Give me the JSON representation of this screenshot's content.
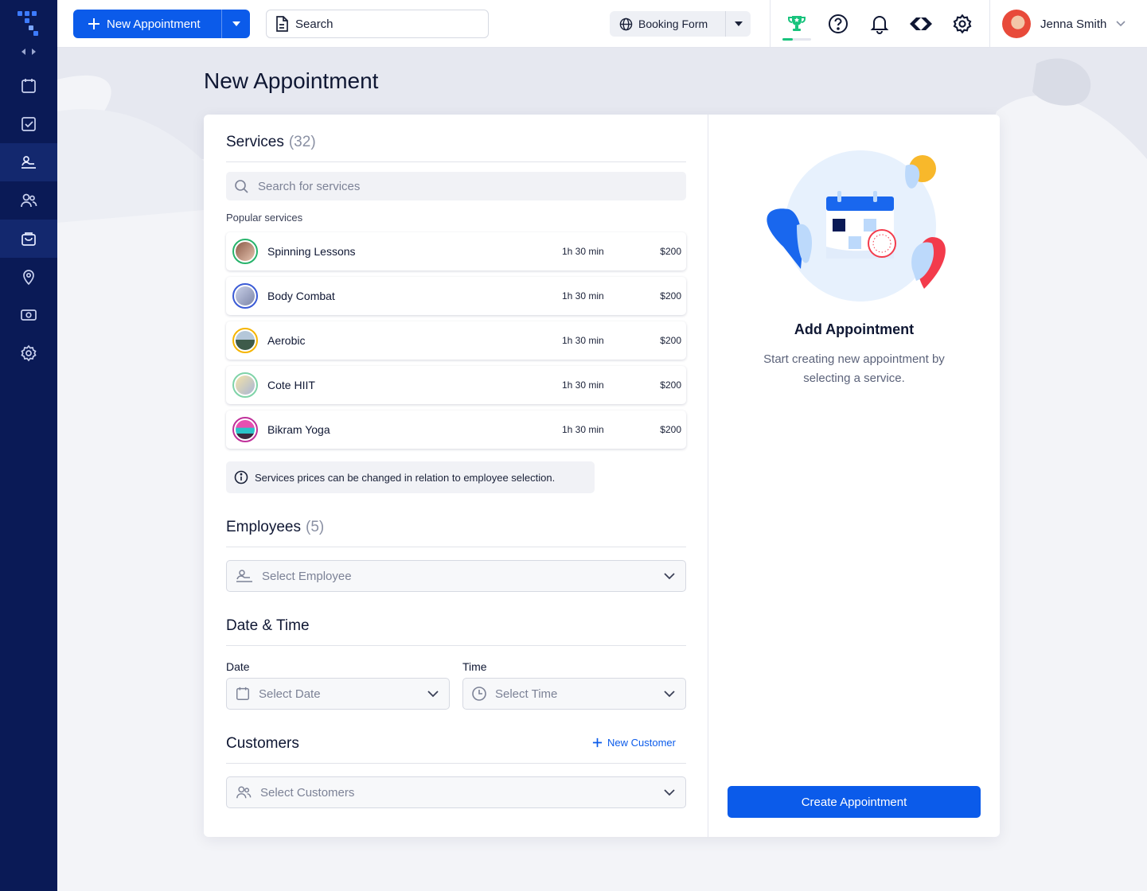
{
  "header": {
    "new_appointment_label": "New Appointment",
    "search_label": "Search",
    "booking_form_label": "Booking Form",
    "user_name": "Jenna Smith"
  },
  "page": {
    "title": "New Appointment"
  },
  "services": {
    "title": "Services",
    "count": "(32)",
    "search_placeholder": "Search for services",
    "popular_label": "Popular services",
    "items": [
      {
        "name": "Spinning Lessons",
        "duration": "1h 30 min",
        "price": "$200",
        "ring": "#27b36b"
      },
      {
        "name": "Body Combat",
        "duration": "1h 30 min",
        "price": "$200",
        "ring": "#3b5bd6"
      },
      {
        "name": "Aerobic",
        "duration": "1h 30 min",
        "price": "$200",
        "ring": "#f5b400"
      },
      {
        "name": "Cote HIIT",
        "duration": "1h 30 min",
        "price": "$200",
        "ring": "#7fd3a8"
      },
      {
        "name": "Bikram Yoga",
        "duration": "1h 30 min",
        "price": "$200",
        "ring": "#c0309a"
      }
    ],
    "note": "Services prices can be changed in relation to employee selection."
  },
  "employees": {
    "title": "Employees",
    "count": "(5)",
    "placeholder": "Select Employee"
  },
  "datetime": {
    "title": "Date & Time",
    "date_label": "Date",
    "date_placeholder": "Select Date",
    "time_label": "Time",
    "time_placeholder": "Select Time"
  },
  "customers": {
    "title": "Customers",
    "new_label": "New Customer",
    "placeholder": "Select Customers"
  },
  "right": {
    "title": "Add Appointment",
    "description": "Start creating new appointment by selecting a service.",
    "create_label": "Create Appointment"
  },
  "colors": {
    "primary": "#0b5bea",
    "sidebar": "#0a1a56",
    "success": "#19c37d"
  },
  "progress": {
    "achievement": 0.35
  }
}
